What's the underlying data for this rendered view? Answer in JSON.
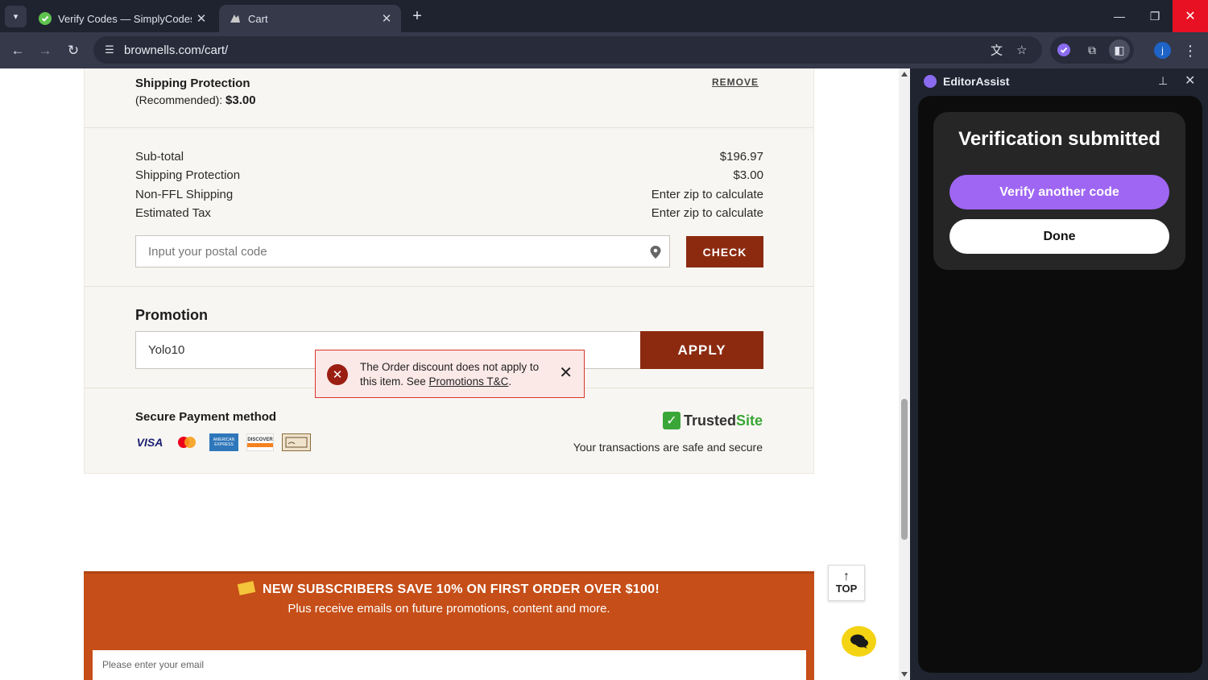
{
  "browser": {
    "tabs": [
      {
        "title": "Verify Codes — SimplyCodes",
        "active": false
      },
      {
        "title": "Cart",
        "active": true
      }
    ],
    "url": "brownells.com/cart/",
    "profile_initial": "j"
  },
  "cart": {
    "shipping_protection": {
      "title": "Shipping Protection",
      "subtitle": "(Recommended):",
      "price": "$3.00",
      "remove_label": "REMOVE"
    },
    "summary": [
      {
        "label": "Sub-total",
        "value": "$196.97"
      },
      {
        "label": "Shipping Protection",
        "value": "$3.00"
      },
      {
        "label": "Non-FFL Shipping",
        "value": "Enter zip to calculate"
      },
      {
        "label": "Estimated Tax",
        "value": "Enter zip to calculate"
      }
    ],
    "postal": {
      "placeholder": "Input your postal code",
      "check_label": "CHECK"
    },
    "promotion": {
      "title": "Promotion",
      "code_value": "Yolo10",
      "apply_label": "APPLY",
      "error_text": "The Order discount does not apply to this item. See ",
      "error_link": "Promotions T&C",
      "error_suffix": "."
    },
    "payment": {
      "title": "Secure Payment method",
      "cards": [
        "VISA",
        "Mastercard",
        "American Express",
        "DISCOVER",
        "Check"
      ],
      "trusted_prefix": "Trusted",
      "trusted_suffix": "Site",
      "secure_text": "Your transactions are safe and secure"
    }
  },
  "subscribe": {
    "headline": "NEW SUBSCRIBERS SAVE 10% ON FIRST ORDER OVER $100!",
    "subline": "Plus receive emails on future promotions, content and more.",
    "email_placeholder": "Please enter your email"
  },
  "top_button_label": "TOP",
  "side_panel": {
    "title": "EditorAssist",
    "heading": "Verification submitted",
    "verify_another_label": "Verify another code",
    "done_label": "Done"
  },
  "colors": {
    "brand_brown": "#8c2a10",
    "subscribe_orange": "#c64e18",
    "panel_purple": "#9f66f3",
    "trusted_green": "#3aa637"
  }
}
